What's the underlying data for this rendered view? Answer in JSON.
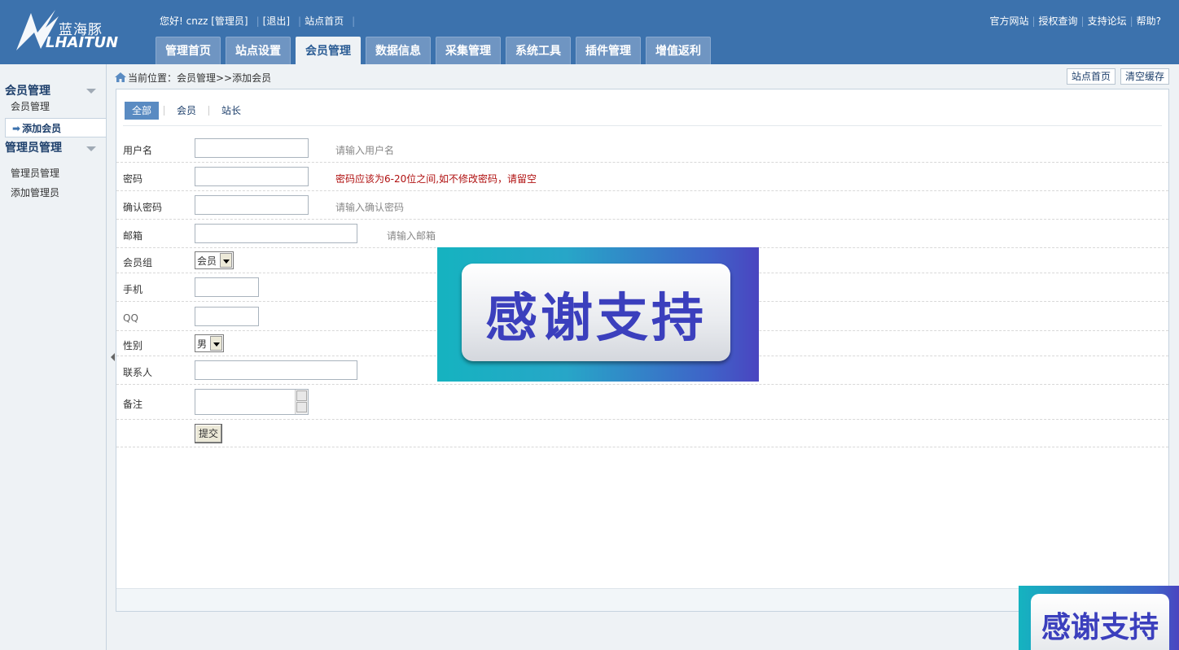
{
  "header": {
    "logo_cn": "蓝海豚",
    "logo_en": "LHAITUN",
    "greeting": "您好! cnzz [管理员]",
    "logout": "[退出]",
    "home_link": "站点首页",
    "links": [
      "官方网站",
      "授权查询",
      "支持论坛",
      "帮助?"
    ]
  },
  "nav": {
    "items": [
      "管理首页",
      "站点设置",
      "会员管理",
      "数据信息",
      "采集管理",
      "系统工具",
      "插件管理",
      "增值返利"
    ],
    "active": "会员管理"
  },
  "sidebar": {
    "groups": [
      {
        "title": "会员管理",
        "items": [
          "会员管理",
          "添加会员"
        ]
      },
      {
        "title": "管理员管理",
        "items": [
          "管理员管理",
          "添加管理员"
        ]
      }
    ],
    "active_item": "添加会员"
  },
  "breadcrumb": "当前位置：会员管理>>添加会员",
  "top_buttons": [
    "站点首页",
    "清空缓存"
  ],
  "subtabs": {
    "items": [
      "全部",
      "会员",
      "站长"
    ],
    "active": "全部"
  },
  "form": {
    "username": {
      "label": "用户名",
      "value": "",
      "hint": "请输入用户名"
    },
    "password": {
      "label": "密码",
      "value": "",
      "hint": "密码应该为6-20位之间,如不修改密码，请留空"
    },
    "confirm": {
      "label": "确认密码",
      "value": "",
      "hint": "请输入确认密码"
    },
    "email": {
      "label": "邮箱",
      "value": "",
      "hint": "请输入邮箱"
    },
    "group": {
      "label": "会员组",
      "value": "会员"
    },
    "mobile": {
      "label": "手机",
      "value": ""
    },
    "qq": {
      "label": "QQ",
      "value": ""
    },
    "gender": {
      "label": "性别",
      "value": "男"
    },
    "contact": {
      "label": "联系人",
      "value": ""
    },
    "remark": {
      "label": "备注",
      "value": ""
    },
    "submit": "提交"
  },
  "overlay": {
    "text": "感谢支持"
  },
  "colors": {
    "header_bg": "#3c72ad",
    "active_tab": "#5a8bc2",
    "warn": "#b01010"
  }
}
